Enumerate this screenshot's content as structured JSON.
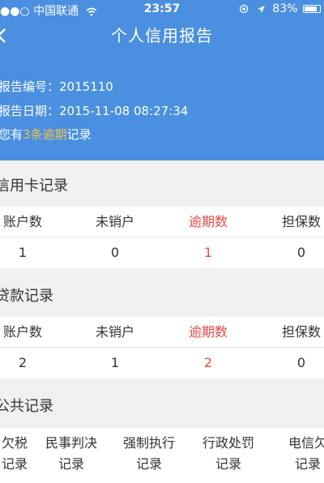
{
  "status_bar": {
    "carrier": "●●○ 中国联通",
    "wifi_icon": "wifi-icon",
    "time": "23:57",
    "location_icon": "location-arrow-icon",
    "battery_percent": "83%",
    "battery_level": 0.83
  },
  "header": {
    "title": "个人信用报告",
    "report_no_label": "报告编号：",
    "report_no_value": "2015110",
    "report_date_label": "报告日期：",
    "report_date_value": "2015-11-08 08:27:34",
    "summary_prefix": "您有",
    "summary_highlight": "3条逾期",
    "summary_suffix": "记录"
  },
  "credit_card": {
    "title": "信用卡记录",
    "headers": [
      "账户数",
      "未销户",
      "逾期数",
      "担保数"
    ],
    "values": [
      "1",
      "0",
      "1",
      "0"
    ]
  },
  "loan": {
    "title": "贷款记录",
    "headers": [
      "账户数",
      "未销户",
      "逾期数",
      "担保数"
    ],
    "values": [
      "2",
      "1",
      "2",
      "0"
    ]
  },
  "public": {
    "title": "公共记录",
    "items": [
      {
        "line1": "欠税",
        "line2": "记录"
      },
      {
        "line1": "民事判决",
        "line2": "记录"
      },
      {
        "line1": "强制执行",
        "line2": "记录"
      },
      {
        "line1": "行政处罚",
        "line2": "记录"
      },
      {
        "line1": "电信欠",
        "line2": "记录"
      }
    ]
  },
  "colors": {
    "header_bg": "#4a8fe0",
    "highlight": "#f5c343",
    "overdue_red": "#e24a4a"
  }
}
